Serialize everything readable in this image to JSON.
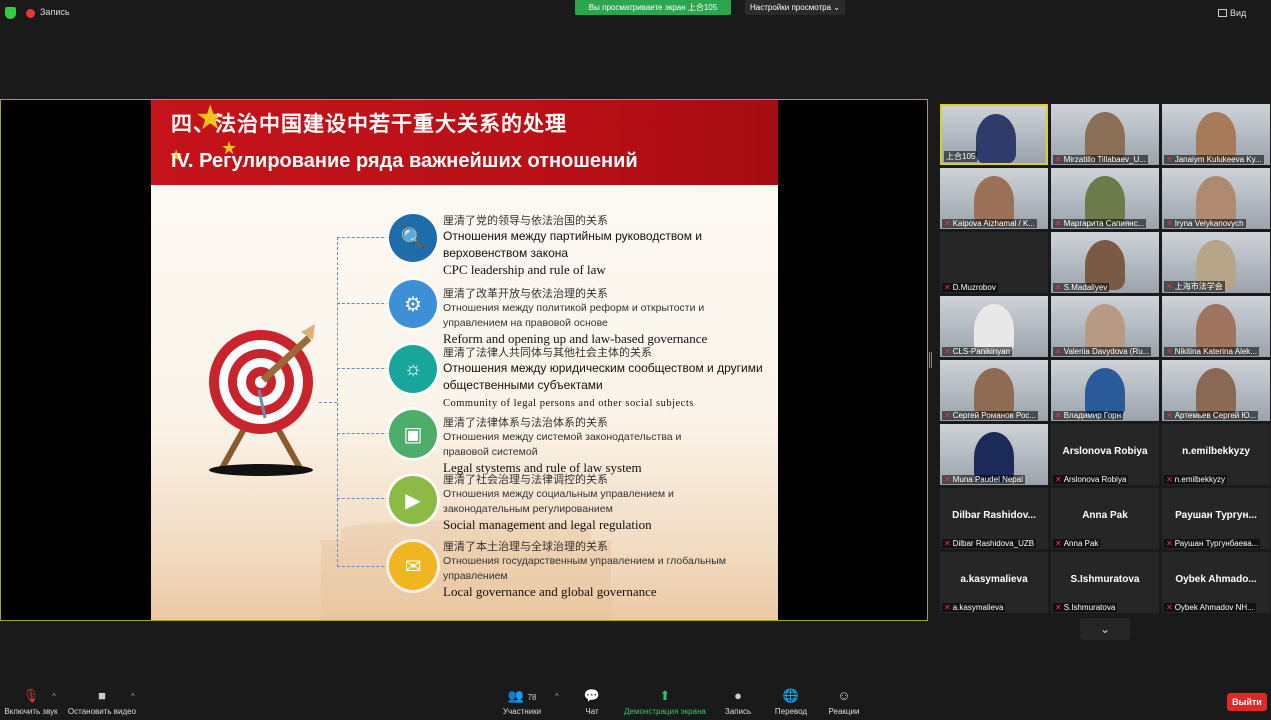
{
  "topbar": {
    "recording_label": "Запись",
    "share_banner": "Вы просматриваете экран 上合105",
    "view_settings": "Настройки просмотра",
    "view_label": "Вид"
  },
  "slide": {
    "title_cn": "四、法治中国建设中若干重大关系的处理",
    "title_ru": "IV. Регулирование ряда важнейших отношений",
    "items": [
      {
        "cn": "厘清了党的领导与依法治国的关系",
        "ru": "Отношения между партийным руководством и верховенством закона",
        "en": "CPC leadership and rule of law",
        "icon": "magnifier-icon",
        "color": "#1f6da8"
      },
      {
        "cn": "厘清了改革开放与依法治理的关系",
        "ru": "Отношения между политикой реформ и открытости и управлением на правовой основе",
        "en": "Reform and opening up and law-based governance",
        "icon": "gear-icon",
        "color": "#3d8fd6"
      },
      {
        "cn": "厘清了法律人共同体与其他社会主体的关系",
        "ru": "Отношения между юридическим сообществом и другими общественными субъектами",
        "en": "Community of legal persons and other social subjects",
        "icon": "bulb-icon",
        "color": "#1aa59c"
      },
      {
        "cn": "厘清了法律体系与法治体系的关系",
        "ru": "Отношения между системой законодательства и правовой системой",
        "en": "Legal stystems and rule of law system",
        "icon": "camera-icon",
        "color": "#4cae6a"
      },
      {
        "cn": "厘清了社会治理与法律调控的关系",
        "ru": "Отношения между социальным управлением и законодательным регулированием",
        "en": "Social management and legal regulation",
        "icon": "play-icon",
        "color": "#8cba45"
      },
      {
        "cn": "厘清了本土治理与全球治理的关系",
        "ru": "Отношения государственным управлением и глобальным управлением",
        "en": "Local governance and global governance",
        "icon": "mail-icon",
        "color": "#f0b61f"
      }
    ]
  },
  "participants": [
    {
      "name": "上合105",
      "big": ""
    },
    {
      "name": "Mirzatillo Tillabaev_U...",
      "big": ""
    },
    {
      "name": "Janaiym Kulukeeva Ky...",
      "big": ""
    },
    {
      "name": "Kaipova Aizhamal / K...",
      "big": ""
    },
    {
      "name": "Маргарита Сапиянс...",
      "big": ""
    },
    {
      "name": "Iryna Velykanovych",
      "big": ""
    },
    {
      "name": "D.Muzrobov",
      "big": ""
    },
    {
      "name": "S.Madaliyev",
      "big": ""
    },
    {
      "name": "上海市法学会",
      "big": ""
    },
    {
      "name": "CLS-Panikinyan",
      "big": ""
    },
    {
      "name": "Valeriia Davydova (Ru...",
      "big": ""
    },
    {
      "name": "Nikitina Katerina Alek...",
      "big": ""
    },
    {
      "name": "Сергей Романов Рос...",
      "big": ""
    },
    {
      "name": "Владимир Горн",
      "big": ""
    },
    {
      "name": "Артемьев Сергей Ю...",
      "big": ""
    },
    {
      "name": "Muna Paudel Nepal",
      "big": ""
    },
    {
      "name": "Arslonova Robiya",
      "big": "Arslonova Robiya"
    },
    {
      "name": "n.emilbekkyzy",
      "big": "n.emilbekkyzy"
    },
    {
      "name": "Dilbar Rashidova_UZB",
      "big": "Dilbar Rashidov..."
    },
    {
      "name": "Anna Pak",
      "big": "Anna Pak"
    },
    {
      "name": "Раушан Тургунбаева...",
      "big": "Раушан Тургун..."
    },
    {
      "name": "a.kasymalieva",
      "big": "a.kasymalieva"
    },
    {
      "name": "S.Ishmuratova",
      "big": "S.Ishmuratova"
    },
    {
      "name": "Oybek Ahmadov NH...",
      "big": "Oybek Ahmado..."
    }
  ],
  "toolbar": {
    "mute": "Включить звук",
    "video": "Остановить видео",
    "participants_count": "78",
    "participants": "Участники",
    "chat": "Чат",
    "share": "Демонстрация экрана",
    "record": "Запись",
    "translate": "Перевод",
    "reactions": "Реакции",
    "exit": "Выйти"
  }
}
